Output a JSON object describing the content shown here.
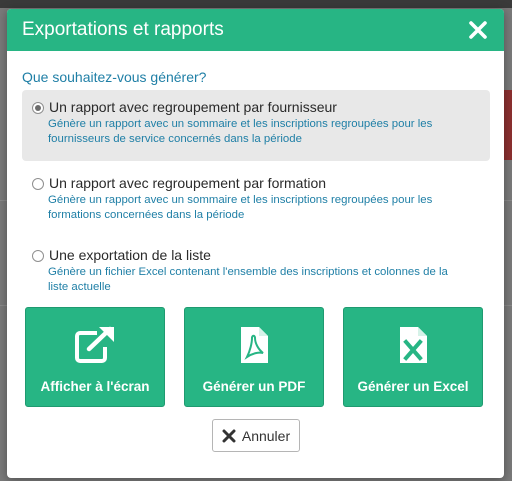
{
  "modal": {
    "title": "Exportations et rapports",
    "question": "Que souhaitez-vous générer?"
  },
  "options": [
    {
      "label": "Un rapport avec regroupement par fournisseur",
      "description": "Génère un rapport avec un sommaire et les inscriptions regroupées pour les fournisseurs de service concernés dans la période",
      "selected": true
    },
    {
      "label": "Un rapport avec regroupement par formation",
      "description": "Génère un rapport avec un sommaire et les inscriptions regroupées pour les formations concernées dans la période",
      "selected": false
    },
    {
      "label": "Une exportation de la liste",
      "description": "Génère un fichier Excel contenant l'ensemble des inscriptions et colonnes de la liste actuelle",
      "selected": false
    }
  ],
  "actions": [
    {
      "label": "Afficher à l'écran",
      "icon": "external-link-icon"
    },
    {
      "label": "Générer un PDF",
      "icon": "pdf-file-icon"
    },
    {
      "label": "Générer un Excel",
      "icon": "excel-file-icon"
    }
  ],
  "cancel": {
    "label": "Annuler",
    "icon": "close-icon"
  },
  "colors": {
    "accent": "#27b584",
    "link": "#1f7fa6"
  }
}
